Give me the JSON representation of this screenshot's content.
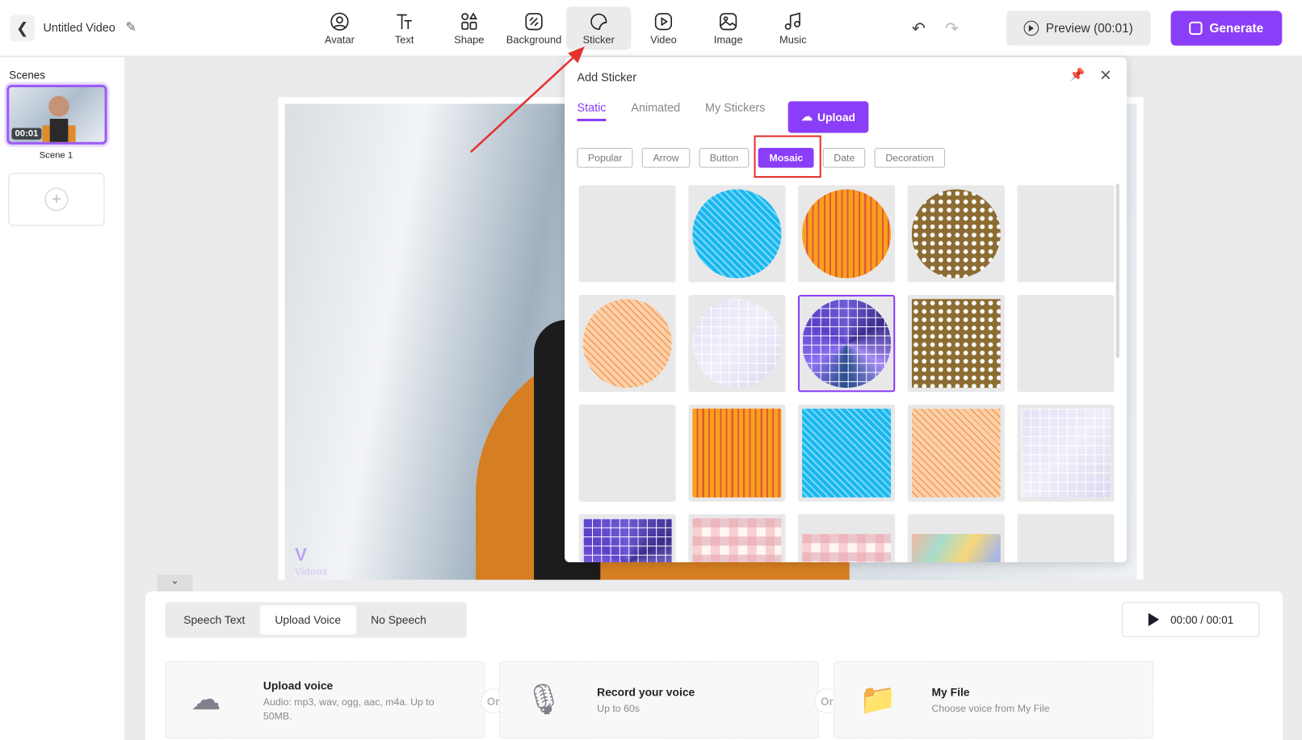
{
  "header": {
    "title": "Untitled Video",
    "undo_icon": "undo-icon",
    "redo_icon": "redo-icon",
    "preview_label": "Preview (00:01)",
    "generate_label": "Generate",
    "tools": [
      {
        "label": "Avatar",
        "icon": "avatar-icon"
      },
      {
        "label": "Text",
        "icon": "text-icon"
      },
      {
        "label": "Shape",
        "icon": "shape-icon"
      },
      {
        "label": "Background",
        "icon": "background-icon"
      },
      {
        "label": "Sticker",
        "icon": "sticker-icon",
        "active": true
      },
      {
        "label": "Video",
        "icon": "video-icon"
      },
      {
        "label": "Image",
        "icon": "image-icon"
      },
      {
        "label": "Music",
        "icon": "music-icon"
      }
    ]
  },
  "sidebar": {
    "label": "Scenes",
    "scenes": [
      {
        "name": "Scene 1",
        "duration": "00:01"
      }
    ]
  },
  "canvas": {
    "watermark": "Vidnoz"
  },
  "sticker_panel": {
    "title": "Add Sticker",
    "tabs": [
      "Static",
      "Animated",
      "My Stickers"
    ],
    "active_tab": "Static",
    "upload_label": "Upload",
    "categories": [
      "Popular",
      "Arrow",
      "Button",
      "Mosaic",
      "Date",
      "Decoration"
    ],
    "active_category": "Mosaic",
    "selected_index": 7
  },
  "voice": {
    "tabs": [
      "Speech Text",
      "Upload Voice",
      "No Speech"
    ],
    "active_tab": "Upload Voice",
    "time": "00:00 / 00:01",
    "or_label": "Or",
    "options": [
      {
        "title": "Upload voice",
        "desc": "Audio: mp3, wav, ogg, aac, m4a. Up to 50MB.",
        "icon": "cloud-upload-icon"
      },
      {
        "title": "Record your voice",
        "desc": "Up to 60s",
        "icon": "microphone-icon"
      },
      {
        "title": "My File",
        "desc": "Choose voice from My File",
        "icon": "folder-icon"
      }
    ]
  },
  "colors": {
    "accent": "#8b3ef7",
    "highlight": "#e5322f"
  }
}
